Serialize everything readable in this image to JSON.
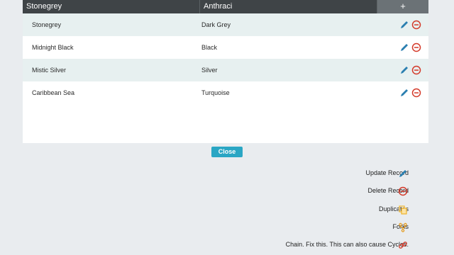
{
  "editor": {
    "input_first": "Stonegrey",
    "input_second": "Anthraci",
    "add_label": "+"
  },
  "records": [
    {
      "name": "Stonegrey",
      "color": "Dark Grey"
    },
    {
      "name": "Midnight Black",
      "color": "Black"
    },
    {
      "name": "Mistic Silver",
      "color": "Silver"
    },
    {
      "name": "Caribbean Sea",
      "color": "Turquoise"
    }
  ],
  "close_label": "Close",
  "legend": [
    {
      "label": "Update Record",
      "icon": "pencil-icon",
      "color": "#2a7fb0"
    },
    {
      "label": "Delete Record",
      "icon": "minus-circle-icon",
      "color": "#d43a2a"
    },
    {
      "label": "Duplicates",
      "icon": "copy-icon",
      "color": "#f0b429"
    },
    {
      "label": "Forks",
      "icon": "fork-icon",
      "color": "#e59a1a"
    },
    {
      "label": "Chain. Fix this. This can also cause Cycles.",
      "icon": "link-icon",
      "color": "#d43a2a"
    }
  ]
}
